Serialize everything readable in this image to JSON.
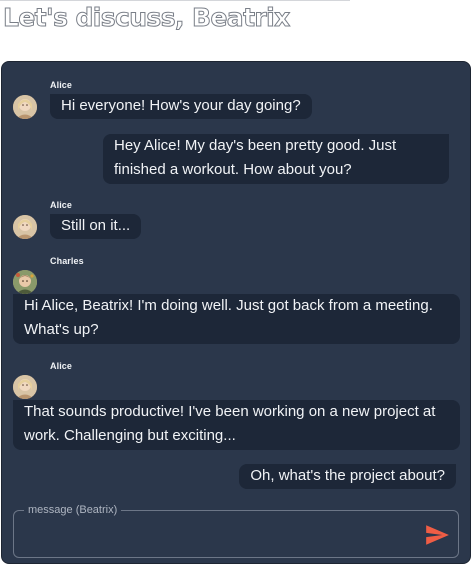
{
  "page": {
    "title": "Let's discuss, Beatrix"
  },
  "messages": [
    {
      "sender": "Alice",
      "text": "Hi everyone! How's your day going?",
      "side": "left"
    },
    {
      "sender": "",
      "text": "Hey Alice! My day's been pretty good. Just finished a workout. How about you?",
      "side": "right"
    },
    {
      "sender": "Alice",
      "text": "Still on it...",
      "side": "left"
    },
    {
      "sender": "Charles",
      "text": "Hi Alice, Beatrix! I'm doing well. Just got back from a meeting. What's up?",
      "side": "left"
    },
    {
      "sender": "Alice",
      "text": "That sounds productive! I've been working on a new project at work. Challenging but exciting...",
      "side": "left"
    },
    {
      "sender": "",
      "text": "Oh, what's the project about?",
      "side": "right"
    }
  ],
  "composer": {
    "legend": "message (Beatrix)",
    "value": "",
    "send_icon": "send-icon"
  },
  "colors": {
    "panel": "#2b374b",
    "bubble": "#1d2738",
    "text": "#f1f3f6",
    "send_accent": "#ef5d45"
  }
}
